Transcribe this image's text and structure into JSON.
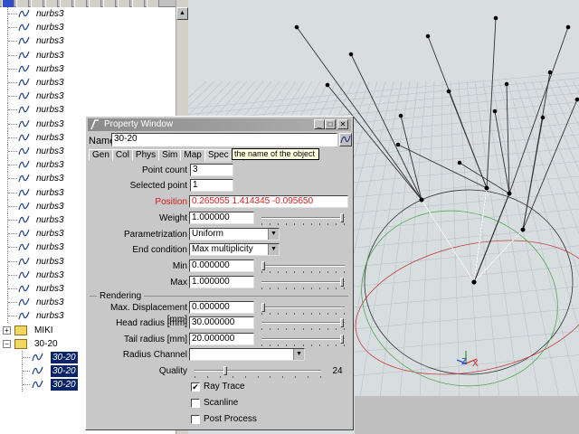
{
  "outliner": {
    "nurbs_items": [
      "nurbs3",
      "nurbs3",
      "nurbs3",
      "nurbs3",
      "nurbs3",
      "nurbs3",
      "nurbs3",
      "nurbs3",
      "nurbs3",
      "nurbs3",
      "nurbs3",
      "nurbs3",
      "nurbs3",
      "nurbs3",
      "nurbs3",
      "nurbs3",
      "nurbs3",
      "nurbs3",
      "nurbs3",
      "nurbs3",
      "nurbs3",
      "nurbs3",
      "nurbs3"
    ],
    "folder_miki": "MIKI",
    "folder_30_20": "30-20",
    "children": [
      "30-20",
      "30-20",
      "30-20"
    ]
  },
  "property_window": {
    "title": "Property Window",
    "title_buttons": [
      "_",
      "□",
      "✕"
    ],
    "name_label": "Name",
    "name_value": "30-20",
    "tabs": [
      "Gen",
      "Col",
      "Phys",
      "Sim",
      "Map",
      "Spec",
      "S"
    ],
    "active_tab": "Spec",
    "tooltip": "the name of the object",
    "point_count": {
      "label": "Point count",
      "value": "3"
    },
    "selected_point": {
      "label": "Selected point",
      "value": "1"
    },
    "position": {
      "label": "Position",
      "value": "0.265055 1.414345 -0.095650"
    },
    "weight": {
      "label": "Weight",
      "value": "1.000000",
      "slider": 1.0
    },
    "parametrization": {
      "label": "Parametrization",
      "value": "Uniform"
    },
    "end_condition": {
      "label": "End condition",
      "value": "Max multiplicity"
    },
    "min": {
      "label": "Min",
      "value": "0.000000",
      "slider": 0.0
    },
    "max": {
      "label": "Max",
      "value": "1.000000",
      "slider": 1.0
    },
    "rendering": {
      "legend": "Rendering",
      "max_displacement": {
        "label": "Max. Displacement [mm]",
        "value": "0.000000",
        "slider": 0.0
      },
      "head_radius": {
        "label": "Head radius [mm]",
        "value": "30.000000",
        "slider": 1.0
      },
      "tail_radius": {
        "label": "Tail radius [mm]",
        "value": "20.000000",
        "slider": 1.0
      },
      "radius_channel": {
        "label": "Radius Channel",
        "value": ""
      },
      "quality": {
        "label": "Quality",
        "value": "24",
        "slider": 0.24
      },
      "ray_trace": {
        "label": "Ray Trace",
        "checked": true
      },
      "scanline": {
        "label": "Scanline",
        "checked": false
      },
      "post_process": {
        "label": "Post Process",
        "checked": false
      }
    }
  },
  "viewport": {
    "background": "#d8dde0",
    "curve_color": "#303030",
    "selected_curve_color": "#ffffff",
    "axis_x_color": "#d02020",
    "axis_y_color": "#20a020",
    "axis_z_color": "#2040d0",
    "axis_labels": {
      "x": "X",
      "y": "Y",
      "z": "Z"
    }
  }
}
